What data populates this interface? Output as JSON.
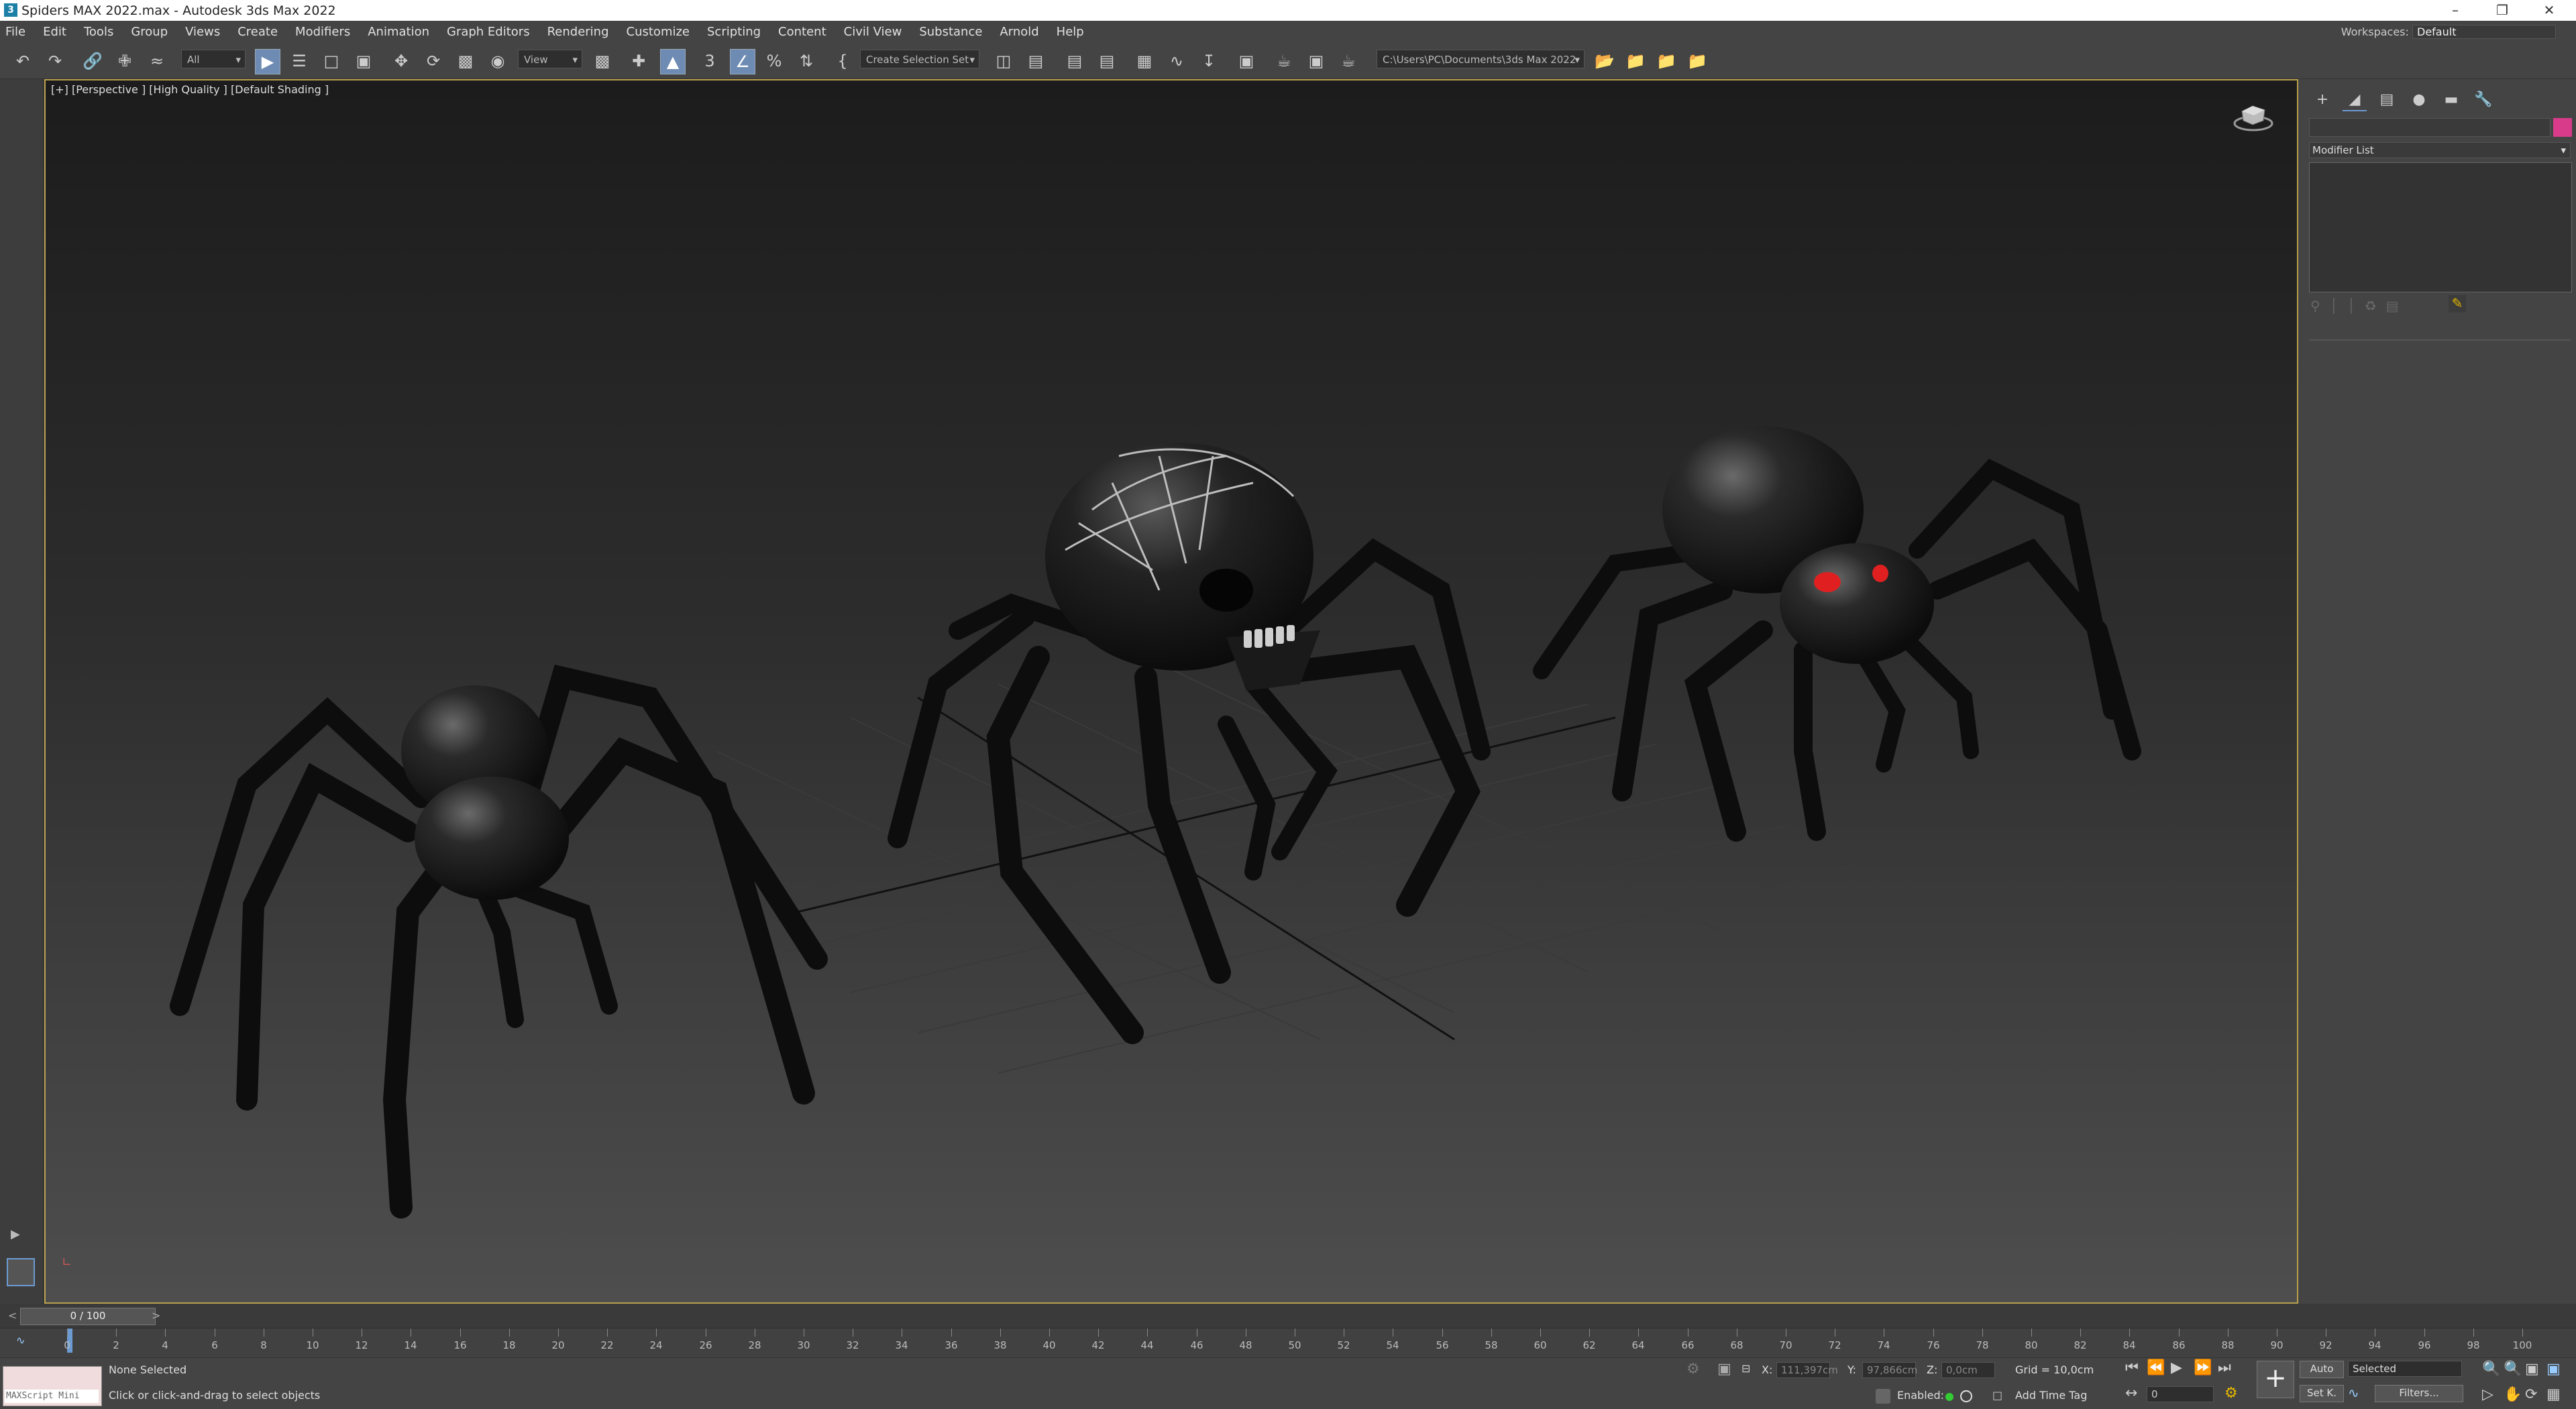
{
  "titlebar": {
    "logo": "3",
    "title": "Spiders MAX 2022.max - Autodesk 3ds Max 2022"
  },
  "menu": [
    "File",
    "Edit",
    "Tools",
    "Group",
    "Views",
    "Create",
    "Modifiers",
    "Animation",
    "Graph Editors",
    "Rendering",
    "Customize",
    "Scripting",
    "Content",
    "Civil View",
    "Substance",
    "Arnold",
    "Help"
  ],
  "workspaces": {
    "label": "Workspaces:",
    "value": "Default"
  },
  "toolbar": {
    "filter_value": "All",
    "ref_coord_value": "View",
    "selection_set_value": "Create Selection Set",
    "project_path": "C:\\Users\\PC\\Documents\\3ds Max 2022"
  },
  "viewport": {
    "label": "[+] [Perspective ] [High Quality ] [Default Shading ]"
  },
  "command_panel": {
    "modifier_list_label": "Modifier List",
    "name_color": "#d83b8a"
  },
  "timeline": {
    "frame_display": "0 / 100",
    "ticks": [
      "0",
      "2",
      "4",
      "6",
      "8",
      "10",
      "12",
      "14",
      "16",
      "18",
      "20",
      "22",
      "24",
      "26",
      "28",
      "30",
      "32",
      "34",
      "36",
      "38",
      "40",
      "42",
      "44",
      "46",
      "48",
      "50",
      "52",
      "54",
      "56",
      "58",
      "60",
      "62",
      "64",
      "66",
      "68",
      "70",
      "72",
      "74",
      "76",
      "78",
      "80",
      "82",
      "84",
      "86",
      "88",
      "90",
      "92",
      "94",
      "96",
      "98",
      "100"
    ]
  },
  "status": {
    "maxscript_placeholder": "MAXScript Mini",
    "selection_status": "None Selected",
    "prompt": "Click or click-and-drag to select objects",
    "x_label": "X:",
    "x_value": "111,397cm",
    "y_label": "Y:",
    "y_value": "97,866cm",
    "z_label": "Z:",
    "z_value": "0,0cm",
    "grid": "Grid = 10,0cm",
    "enabled_label": "Enabled:",
    "add_time_tag": "Add Time Tag",
    "auto_label": "Auto",
    "set_key_label": "Set K.",
    "key_mode_value": "Selected",
    "filters_label": "Filters...",
    "current_frame": "0"
  },
  "colors": {
    "accent": "#6e8bb3",
    "viewport_border": "#b8a04c",
    "eye_red": "#e02020"
  }
}
